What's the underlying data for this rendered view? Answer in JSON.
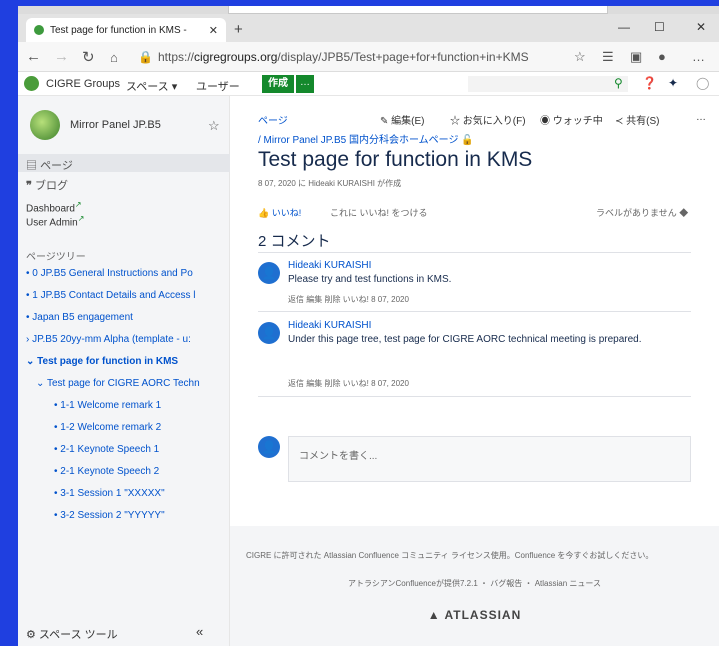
{
  "browser": {
    "tab_title": "Test page for function in KMS -  ",
    "new_tab": "+",
    "url_prefix": "https://",
    "url_host": "cigregroups.org",
    "url_path": "/display/JPB5/Test+page+for+function+in+KMS"
  },
  "header": {
    "site_name": "CIGRE Groups",
    "spaces": "スペース",
    "users": "ユーザー",
    "create": "作成",
    "more": "…"
  },
  "sidebar": {
    "space_name": "Mirror Panel JP.B5",
    "pages": "ページ",
    "blog": "ブログ",
    "dashboard": "Dashboard",
    "user_admin": "User Admin",
    "tree_heading": "ページツリー",
    "tree": [
      "0 JP.B5 General Instructions and Po",
      "1 JP.B5 Contact Details and Access l",
      "Japan B5 engagement",
      "JP.B5 20yy-mm Alpha (template - u:",
      "Test page for function in KMS",
      "Test page for CIGRE AORC Techn",
      "1-1 Welcome remark 1",
      "1-2 Welcome remark 2",
      "2-1 Keynote Speech 1",
      "2-1 Keynote Speech 2",
      "3-1 Session 1 \"XXXXX\"",
      "3-2 Session 2 \"YYYYY\""
    ],
    "space_tools": "スペース ツール"
  },
  "page": {
    "pages_link": "ページ",
    "edit": "編集(E)",
    "favorite": "お気に入り(F)",
    "watching": "ウォッチ中",
    "share": "共有(S)",
    "breadcrumb": "/ Mirror Panel JP.B5 国内分科会ホームページ",
    "title": "Test page for function in KMS",
    "meta": "8 07, 2020 に Hideaki KURAISHI が作成",
    "like": "いいね!",
    "like_hint": "これに いいね! をつける",
    "no_labels": "ラベルがありません",
    "comments_heading": "2 コメント",
    "comments": [
      {
        "author": "Hideaki KURAISHI",
        "text": "Please try and test functions in KMS.",
        "actions": "返信  編集  削除  いいね!  8 07, 2020"
      },
      {
        "author": "Hideaki KURAISHI",
        "text": "Under this page tree, test page for CIGRE AORC technical meeting is prepared.",
        "actions": "返信  編集  削除  いいね!  8 07, 2020"
      }
    ],
    "comment_placeholder": "コメントを書く..."
  },
  "footer": {
    "license": "CIGRE に許可された Atlassian Confluence コミュニティ ライセンス使用。Confluence を今すぐお試しください。",
    "powered": "アトラシアンConfluenceが提供7.2.1 ・ バグ報告 ・ Atlassian ニュース",
    "brand": "ATLASSIAN"
  }
}
